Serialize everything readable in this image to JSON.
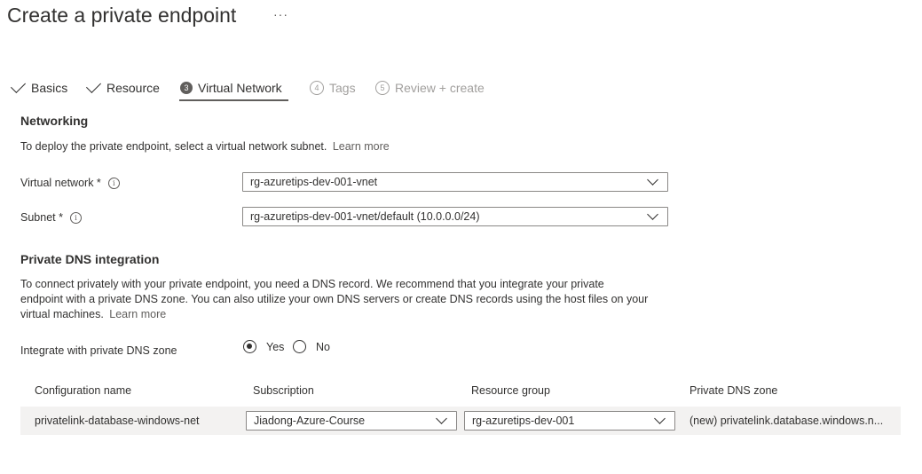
{
  "header": {
    "title": "Create a private endpoint",
    "more_label": "···"
  },
  "tabs": [
    {
      "label": "Basics",
      "state": "completed",
      "icon": "check-icon"
    },
    {
      "label": "Resource",
      "state": "completed",
      "icon": "check-icon"
    },
    {
      "number": "3",
      "label": "Virtual Network",
      "state": "active"
    },
    {
      "number": "4",
      "label": "Tags",
      "state": "disabled"
    },
    {
      "number": "5",
      "label": "Review + create",
      "state": "disabled"
    }
  ],
  "networking": {
    "heading": "Networking",
    "description": "To deploy the private endpoint, select a virtual network subnet.",
    "learn_more": "Learn more",
    "virtual_network": {
      "label": "Virtual network *",
      "value": "rg-azuretips-dev-001-vnet"
    },
    "subnet": {
      "label": "Subnet *",
      "value": "rg-azuretips-dev-001-vnet/default (10.0.0.0/24)"
    }
  },
  "dns": {
    "heading": "Private DNS integration",
    "description_line1": "To connect privately with your private endpoint, you need a DNS record. We recommend that you integrate your private",
    "description_line2": "endpoint with a private DNS zone. You can also utilize your own DNS servers or create DNS records using the host files on your",
    "description_line3": "virtual machines.",
    "learn_more": "Learn more",
    "integrate_label": "Integrate with private DNS zone",
    "options": [
      {
        "label": "Yes",
        "selected": true
      },
      {
        "label": "No",
        "selected": false
      }
    ],
    "table": {
      "headers": [
        "Configuration name",
        "Subscription",
        "Resource group",
        "Private DNS zone"
      ],
      "row": {
        "configuration_name": "privatelink-database-windows-net",
        "subscription": "Jiadong-Azure-Course",
        "resource_group": "rg-azuretips-dev-001",
        "private_dns_zone": "(new) privatelink.database.windows.n..."
      }
    }
  },
  "colors": {
    "text": "#323130",
    "muted": "#605e5c",
    "disabled": "#a19f9d",
    "row_bg": "#f3f2f1",
    "border": "#8a8886"
  }
}
